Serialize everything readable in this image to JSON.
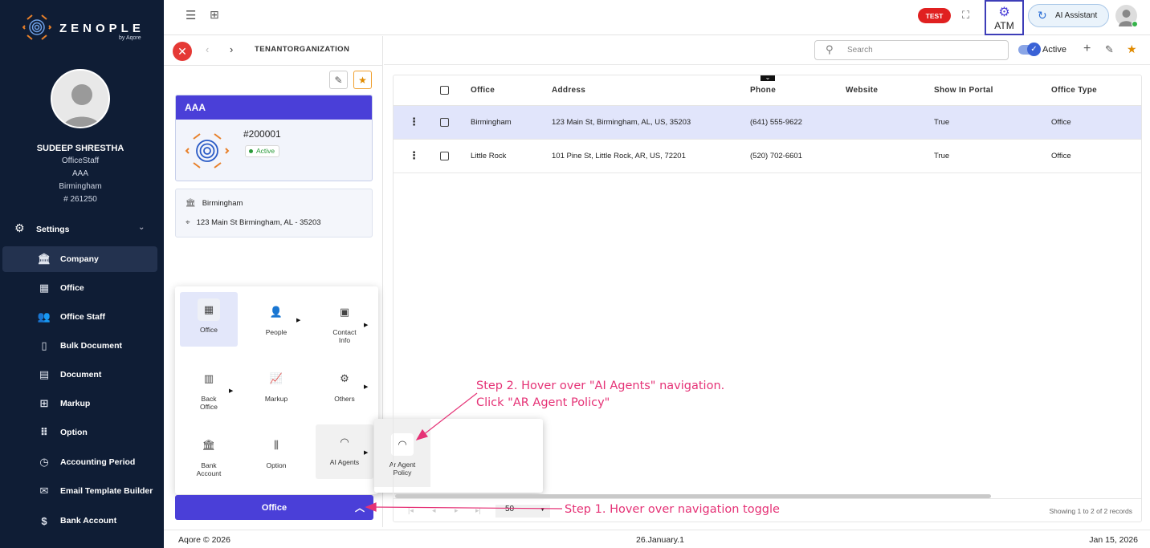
{
  "app": {
    "brand": "ZENOPLE",
    "brand_sub": "by Aqore"
  },
  "profile": {
    "name": "SUDEEP SHRESTHA",
    "role": "OfficeStaff",
    "org": "AAA",
    "office": "Birmingham",
    "id": "# 261250"
  },
  "sidebar": {
    "section": "Settings",
    "items": [
      {
        "label": "Company",
        "icon": "bank-icon"
      },
      {
        "label": "Office",
        "icon": "building-icon"
      },
      {
        "label": "Office Staff",
        "icon": "users-icon"
      },
      {
        "label": "Bulk Document",
        "icon": "file-icon"
      },
      {
        "label": "Document",
        "icon": "document-icon"
      },
      {
        "label": "Markup",
        "icon": "grid-icon"
      },
      {
        "label": "Option",
        "icon": "dots-grid-icon"
      },
      {
        "label": "Accounting Period",
        "icon": "clock-icon"
      },
      {
        "label": "Email Template Builder",
        "icon": "mail-icon"
      },
      {
        "label": "Bank Account",
        "icon": "dollar-icon"
      }
    ]
  },
  "topbar": {
    "badge": "TEST",
    "atm_label": "ATM",
    "ai_button": "AI Assistant"
  },
  "breadcrumb": "TENANTORGANIZATION",
  "record_card": {
    "title": "AAA",
    "id": "#200001",
    "status": "Active",
    "office": "Birmingham",
    "address": "123 Main St Birmingham, AL - 35203"
  },
  "nav_popup": {
    "items": [
      "Office",
      "People",
      "Contact Info",
      "Back Office",
      "Markup",
      "Others",
      "Bank Account",
      "Option",
      "AI Agents"
    ],
    "sub_items": [
      "Ar Agent Policy"
    ]
  },
  "office_toggle": "Office",
  "toolbar": {
    "search_placeholder": "Search",
    "active_label": "Active"
  },
  "table": {
    "columns": [
      "Office",
      "Address",
      "Phone",
      "Website",
      "Show In Portal",
      "Office Type"
    ],
    "rows": [
      {
        "office": "Birmingham",
        "address": "123 Main St, Birmingham, AL, US, 35203",
        "phone": "(641) 555-9622",
        "website": "",
        "portal": "True",
        "type": "Office"
      },
      {
        "office": "Little Rock",
        "address": "101 Pine St, Little Rock, AR, US, 72201",
        "phone": "(520) 702-6601",
        "website": "",
        "portal": "True",
        "type": "Office"
      }
    ],
    "page_size": "50",
    "records_text": "Showing 1 to 2 of 2 records"
  },
  "footer": {
    "copyright": "Aqore © 2026",
    "version": "26.January.1",
    "date": "Jan 15, 2026"
  },
  "annotations": {
    "step1": "Step 1. Hover over navigation toggle",
    "step2_line1": "Step 2. Hover over \"AI Agents\" navigation.",
    "step2_line2": "Click \"AR Agent Policy\""
  },
  "colors": {
    "sidebar": "#0f1d35",
    "accent": "#4a3fd8",
    "highlight_row": "#e1e5fb",
    "annotation": "#e53276",
    "badge": "#e02020"
  }
}
